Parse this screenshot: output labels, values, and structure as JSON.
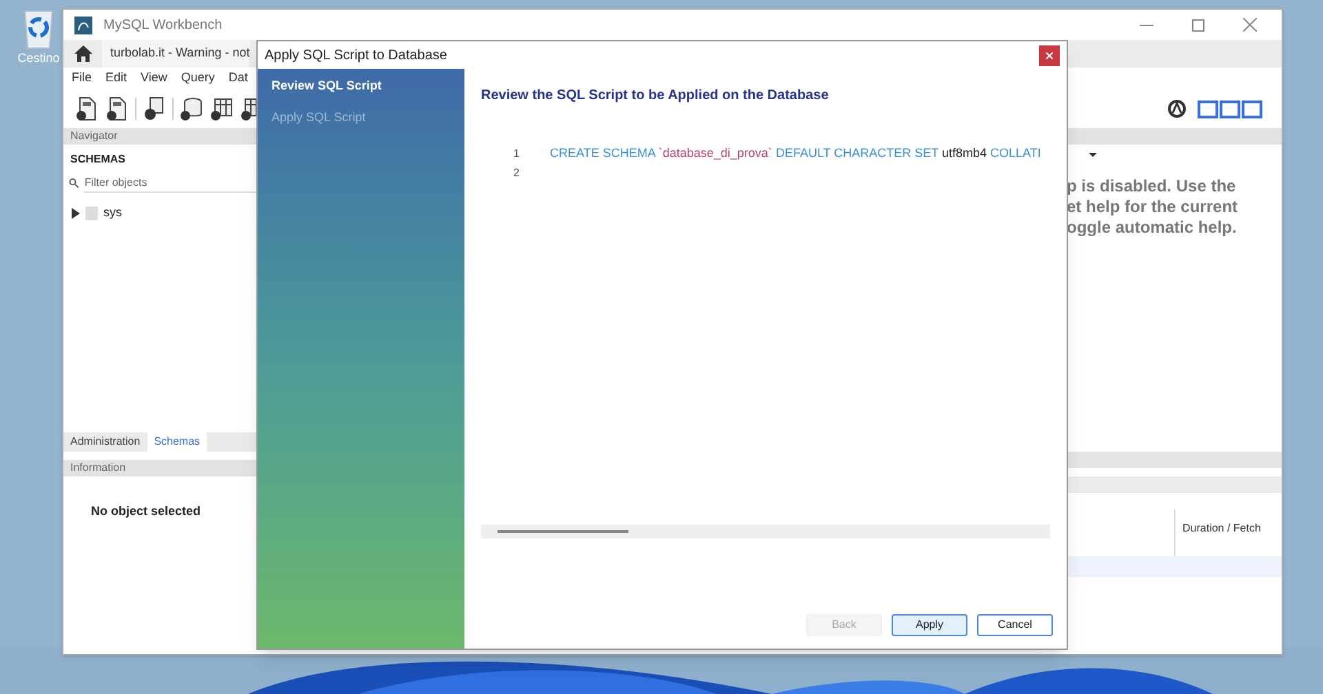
{
  "desktop": {
    "icons": [
      {
        "label": "Cestino"
      }
    ]
  },
  "workbench": {
    "title": "MySQL Workbench",
    "connection_tab": "turbolab.it - Warning - not",
    "menu": [
      "File",
      "Edit",
      "View",
      "Query",
      "Dat"
    ],
    "navigator": {
      "title": "Navigator",
      "schemas_title": "SCHEMAS",
      "filter": {
        "placeholder": "Filter objects"
      },
      "tree": [
        {
          "label": "sys",
          "expanded": false
        }
      ]
    },
    "bottom_tabs": [
      {
        "label": "Administration",
        "selected": false
      },
      {
        "label": "Schemas",
        "selected": true
      }
    ],
    "information": {
      "title": "Information",
      "message": "No object selected"
    },
    "help_text": [
      "p is disabled. Use the",
      "et help for the current",
      "oggle automatic help."
    ],
    "output": {
      "columns": [
        "Duration / Fetch"
      ]
    }
  },
  "dialog": {
    "title": "Apply SQL Script to Database",
    "steps": [
      {
        "label": "Review SQL Script",
        "selected": true
      },
      {
        "label": "Apply SQL Script",
        "selected": false
      }
    ],
    "heading": "Review the SQL Script to be Applied on the Database",
    "script": [
      {
        "number": "1",
        "tokens": [
          {
            "kind": "keyword",
            "text": "CREATE SCHEMA"
          },
          {
            "kind": "string",
            "text": "`database_di_prova`"
          },
          {
            "kind": "keyword",
            "text": "DEFAULT CHARACTER SET"
          },
          {
            "kind": "plain",
            "text": "utf8mb4"
          },
          {
            "kind": "keyword",
            "text": "COLLATI"
          }
        ]
      },
      {
        "number": "2"
      }
    ],
    "buttons": [
      {
        "label": "Back",
        "disabled": true,
        "default": false
      },
      {
        "label": "Apply",
        "disabled": false,
        "default": true
      },
      {
        "label": "Cancel",
        "disabled": false,
        "default": false
      }
    ]
  }
}
